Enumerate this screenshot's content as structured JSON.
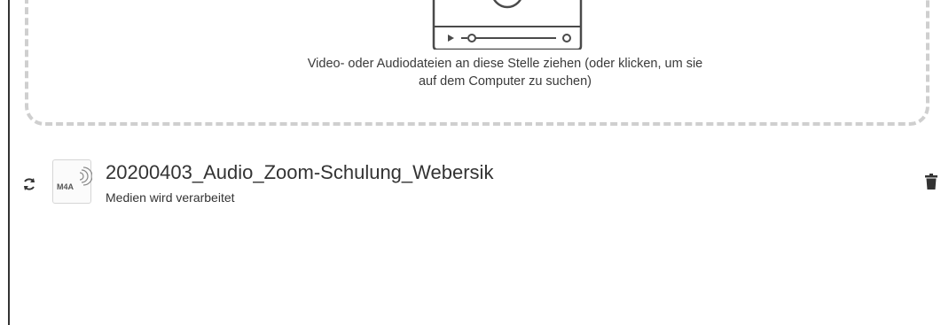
{
  "dropzone": {
    "line1": "Video- oder Audiodateien an diese Stelle ziehen (oder klicken, um sie",
    "line2": "auf dem Computer zu suchen)",
    "illustration_icon": "video-player-icon"
  },
  "upload": {
    "file_name": "20200403_Audio_Zoom-Schulung_Webersik",
    "status": "Medien wird verarbeitet",
    "file_type_badge": "M4A",
    "status_icon": "sync-icon",
    "file_icon": "audio-file-icon",
    "action_icon": "trash-icon"
  },
  "colors": {
    "text": "#333333",
    "dashed_border": "#cfcfcf",
    "icon": "#4a4a4a"
  }
}
